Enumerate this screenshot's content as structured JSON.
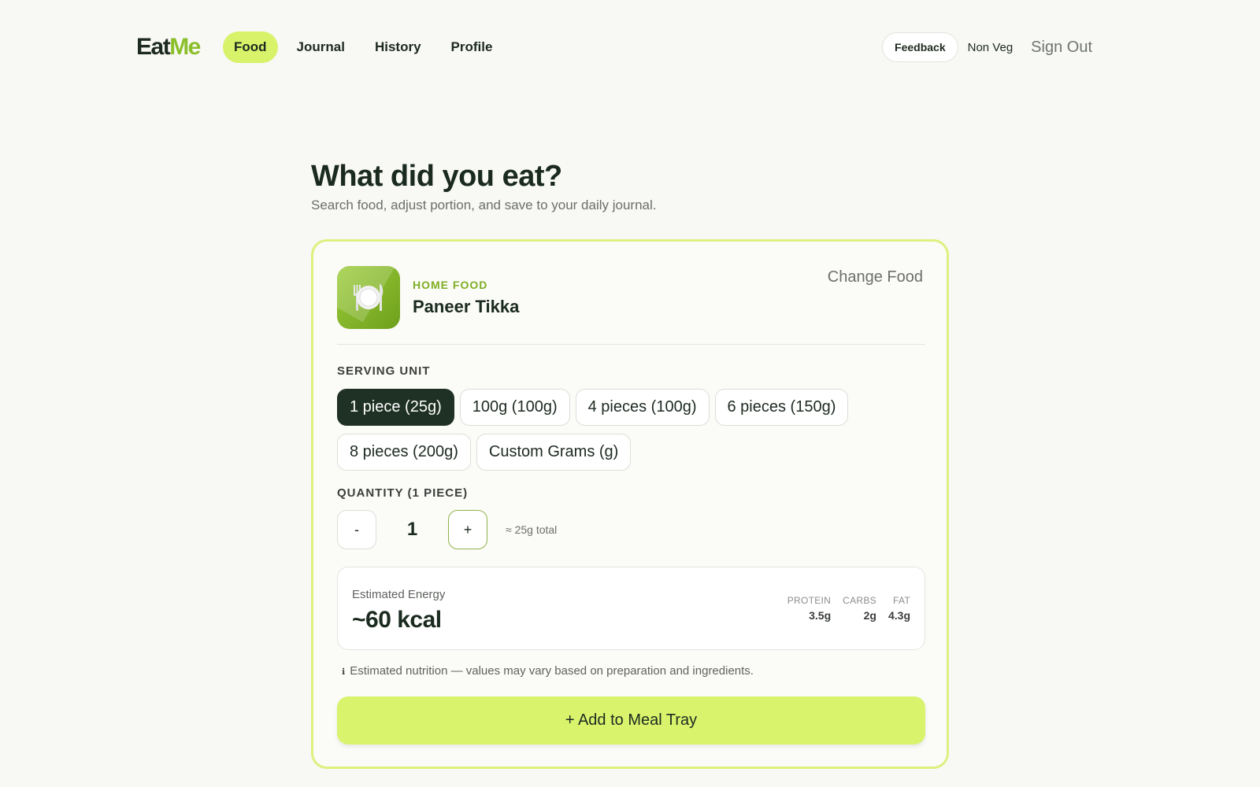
{
  "brand": {
    "logo_part1": "Eat",
    "logo_part2": "Me"
  },
  "nav": {
    "links": [
      {
        "label": "Food",
        "active": true
      },
      {
        "label": "Journal",
        "active": false
      },
      {
        "label": "History",
        "active": false
      },
      {
        "label": "Profile",
        "active": false
      }
    ],
    "feedback_label": "Feedback",
    "diet_label": "Non Veg",
    "signout_label": "Sign Out"
  },
  "header": {
    "title": "What did you eat?",
    "subtitle": "Search food, adjust portion, and save to your daily journal."
  },
  "food": {
    "icon": "plate-cutlery-icon",
    "category": "HOME FOOD",
    "name": "Paneer Tikka",
    "change_label": "Change Food"
  },
  "serving": {
    "label": "SERVING UNIT",
    "units": [
      "1 piece (25g)",
      "100g (100g)",
      "4 pieces (100g)",
      "6 pieces (150g)",
      "8 pieces (200g)",
      "Custom Grams (g)"
    ],
    "selected_index": 0
  },
  "quantity": {
    "label": "QUANTITY (1 PIECE)",
    "minus_label": "-",
    "plus_label": "+",
    "value": "1",
    "total": "≈ 25g total"
  },
  "energy": {
    "label": "Estimated Energy",
    "value": "~60 kcal",
    "macros": [
      {
        "label": "PROTEIN",
        "value": "3.5g"
      },
      {
        "label": "CARBS",
        "value": "2g"
      },
      {
        "label": "FAT",
        "value": "4.3g"
      }
    ]
  },
  "disclaimer": {
    "icon": "info-icon",
    "text": "Estimated nutrition — values may vary based on preparation and ingredients."
  },
  "add_button": {
    "label": "+ Add to Meal Tray"
  },
  "colors": {
    "accent": "#d8f26a",
    "brand_green": "#8bbf2a",
    "dark": "#1f3124",
    "background": "#f8f8f5"
  }
}
